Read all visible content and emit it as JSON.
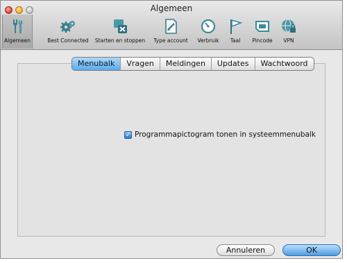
{
  "window": {
    "title": "Algemeen"
  },
  "toolbar": {
    "items": [
      {
        "label": "Algemeen",
        "icon": "tools-icon",
        "selected": true
      },
      {
        "label": "Best Connected",
        "icon": "gears-icon"
      },
      {
        "label": "Starten en stoppen",
        "icon": "start-stop-icon"
      },
      {
        "label": "Type account",
        "icon": "document-icon"
      },
      {
        "label": "Verbruik",
        "icon": "gauge-icon"
      },
      {
        "label": "Taal",
        "icon": "flag-icon"
      },
      {
        "label": "Pincode",
        "icon": "sim-card-icon"
      },
      {
        "label": "VPN",
        "icon": "vpn-globe-icon"
      }
    ]
  },
  "tabs": {
    "items": [
      "Menubalk",
      "Vragen",
      "Meldingen",
      "Updates",
      "Wachtwoord"
    ],
    "active": "Menubalk"
  },
  "settings": {
    "tray_icon_label": "Programmapictogram tonen in systeemmenubalk",
    "tray_icon_checked": true
  },
  "buttons": {
    "cancel": "Annuleren",
    "ok": "OK"
  },
  "colors": {
    "accent": "#4e9de4",
    "tab_active": "#5aaaea",
    "icon_teal": "#3a8a9a"
  }
}
